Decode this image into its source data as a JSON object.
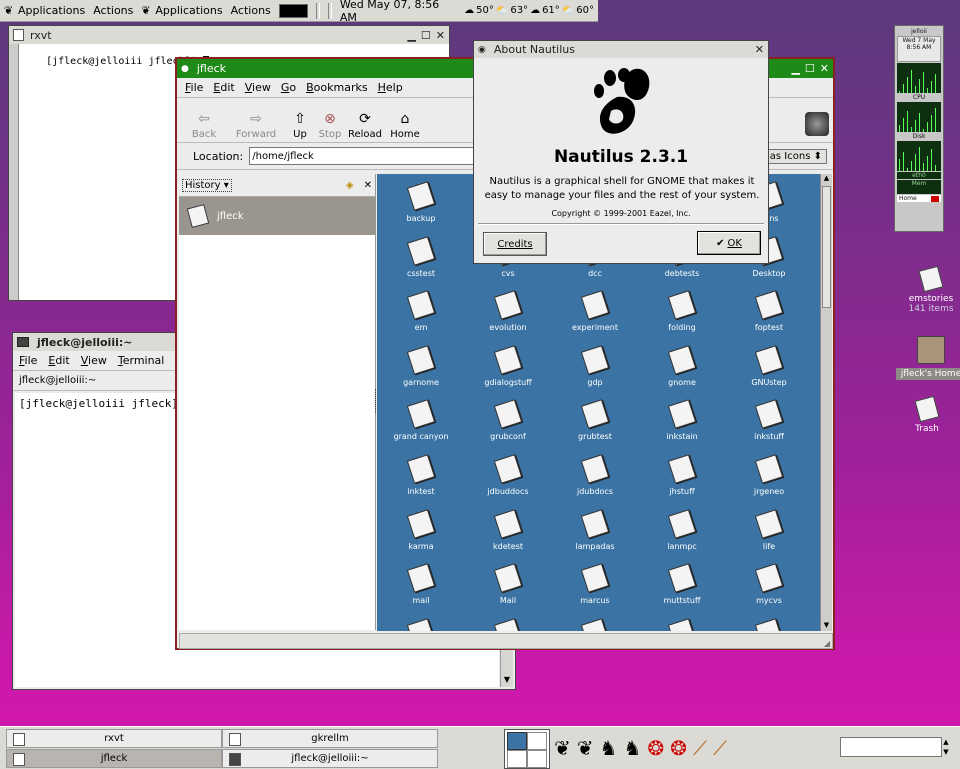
{
  "top_panel": {
    "items": [
      "Applications",
      "Actions",
      "Applications",
      "Actions"
    ],
    "clock": "Wed May 07, 8:56 AM",
    "weather": [
      "50°",
      "63°",
      "61°",
      "60°"
    ]
  },
  "rxvt_window": {
    "title": "rxvt",
    "prompt": "[jfleck@jelloiii jfleck]$ "
  },
  "terminal_window": {
    "title": "jfleck@jelloiii:~",
    "menus": [
      "File",
      "Edit",
      "View",
      "Terminal"
    ],
    "tab_label": "jfleck@jelloiii:~",
    "prompt": "[jfleck@jelloiii jfleck]$"
  },
  "nautilus": {
    "title": "jfleck",
    "menus": [
      "File",
      "Edit",
      "View",
      "Go",
      "Bookmarks",
      "Help"
    ],
    "toolbar": [
      "Back",
      "Forward",
      "Up",
      "Stop",
      "Reload",
      "Home"
    ],
    "location_label": "Location:",
    "location_value": "/home/jfleck",
    "view_as": "as Icons",
    "sidebar_selector": "History",
    "sidebar_item": "jfleck",
    "files": [
      "backup",
      "",
      "",
      "",
      "nons",
      "csstest",
      "cvs",
      "dcc",
      "debtests",
      "Desktop",
      "em",
      "evolution",
      "experiment",
      "folding",
      "foptest",
      "garnome",
      "gdialogstuff",
      "gdp",
      "gnome",
      "GNUstep",
      "grand canyon",
      "grubconf",
      "grubtest",
      "inkstain",
      "inkstuff",
      "inktest",
      "jdbuddocs",
      "jdubdocs",
      "jhstuff",
      "jrgeneo",
      "karma",
      "kdetest",
      "lampadas",
      "lanmpc",
      "life",
      "mail",
      "Mail",
      "marcus",
      "muttstuff",
      "mycvs"
    ]
  },
  "about_dialog": {
    "title": "About Nautilus",
    "heading": "Nautilus 2.3.1",
    "description": "Nautilus is a graphical shell for GNOME that makes it easy to manage your files and the rest of your system.",
    "copyright": "Copyright © 1999-2001 Eazel, Inc.",
    "credits_button": "Credits",
    "ok_button": "OK"
  },
  "desktop_icons": [
    {
      "label": "emstories",
      "sub": "141 items"
    },
    {
      "label": "jfleck's Home",
      "sub": ""
    },
    {
      "label": "Trash",
      "sub": ""
    }
  ],
  "gkrellm": {
    "host": "jelloii",
    "date": "Wed 7 May",
    "time": "8:56 AM",
    "labels": [
      "CPU",
      "Disk",
      "eth0",
      "Mem",
      "Home"
    ]
  },
  "taskbar": {
    "tasks": [
      "rxvt",
      "gkrellm",
      "jfleck",
      "jfleck@jelloiii:~"
    ]
  }
}
